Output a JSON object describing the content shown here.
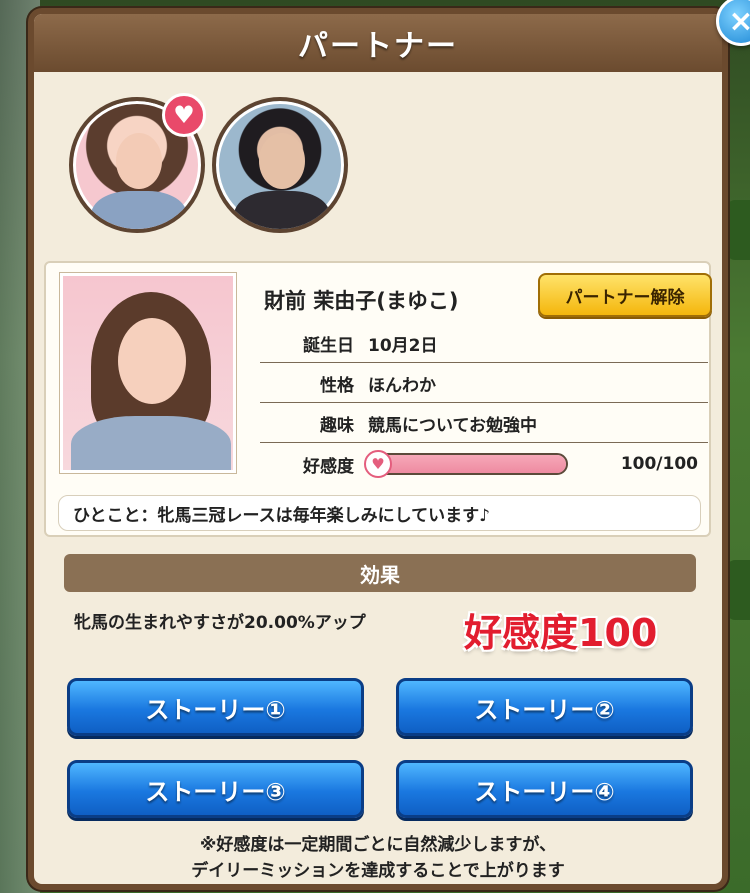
{
  "dialog": {
    "title": "パートナー",
    "close_icon": "×"
  },
  "partners": [
    {
      "name": "財前 茉由子",
      "selected": true,
      "heart_icon": "♥"
    },
    {
      "name": "partner-2",
      "selected": false
    }
  ],
  "profile": {
    "name": "財前 茉由子(まゆこ)",
    "release_button": "パートナー解除",
    "birthday_label": "誕生日",
    "birthday_value": "10月2日",
    "personality_label": "性格",
    "personality_value": "ほんわか",
    "hobby_label": "趣味",
    "hobby_value": "競馬についてお勉強中",
    "affection_label": "好感度",
    "affection_value": "100/100",
    "affection_fraction": 1.0,
    "comment": "ひとこと：牝馬三冠レースは毎年楽しみにしています♪"
  },
  "effect": {
    "header": "効果",
    "text": "牝馬の生まれやすさが20.00%アップ",
    "badge": "好感度100"
  },
  "stories": {
    "story1": "ストーリー①",
    "story2": "ストーリー②",
    "story3": "ストーリー③",
    "story4": "ストーリー④"
  },
  "note": {
    "line1": "※好感度は一定期間ごとに自然減少しますが、",
    "line2": "デイリーミッションを達成することで上がります"
  },
  "colors": {
    "panel_border": "#6b4a2e",
    "story_button": "#1a78e0",
    "release_button": "#f4b60c",
    "badge_red": "#e21d2f"
  }
}
